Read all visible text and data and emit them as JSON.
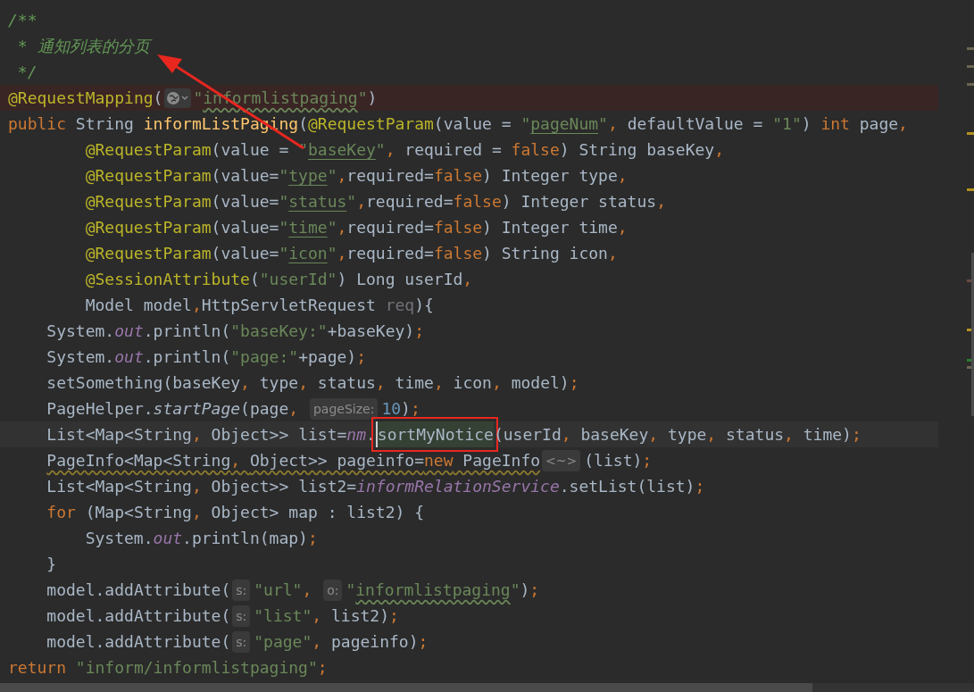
{
  "editor": {
    "lines": [
      {
        "kind": "top",
        "tokens": [
          {
            "text": "/**",
            "kind": "doc"
          }
        ]
      },
      {
        "kind": "top",
        "tokens": [
          {
            "text": " * 通知列表的分页",
            "kind": "doc"
          }
        ]
      },
      {
        "kind": "top",
        "tokens": [
          {
            "text": " */",
            "kind": "doc"
          }
        ]
      },
      {
        "kind": "error",
        "tokens": [
          {
            "text": "@RequestMapping",
            "kind": "ann"
          },
          {
            "text": "(",
            "kind": "plain"
          },
          {
            "kind": "globe"
          },
          {
            "text": "\"",
            "kind": "str"
          },
          {
            "text": "informlistpaging",
            "kind": "str",
            "typo": true
          },
          {
            "text": "\"",
            "kind": "str"
          },
          {
            "text": ")",
            "kind": "plain"
          }
        ]
      },
      {
        "kind": "top",
        "tokens": [
          {
            "text": "public",
            "kind": "kw"
          },
          {
            "text": " String ",
            "kind": "plain"
          },
          {
            "text": "informListPaging",
            "kind": "method"
          },
          {
            "text": "(",
            "kind": "plain"
          },
          {
            "text": "@RequestParam",
            "kind": "ann"
          },
          {
            "text": "(value = ",
            "kind": "plain"
          },
          {
            "text": "\"",
            "kind": "str"
          },
          {
            "text": "pageNum",
            "kind": "str",
            "link": true
          },
          {
            "text": "\"",
            "kind": "str"
          },
          {
            "text": ", ",
            "kind": "kw"
          },
          {
            "text": "defaultValue = ",
            "kind": "plain"
          },
          {
            "text": "\"1\"",
            "kind": "str"
          },
          {
            "text": ") ",
            "kind": "plain"
          },
          {
            "text": "int",
            "kind": "kw"
          },
          {
            "text": " page",
            "kind": "plain"
          },
          {
            "text": ",",
            "kind": "kw"
          }
        ]
      },
      {
        "kind": "param",
        "tokens": [
          {
            "text": "@RequestParam",
            "kind": "ann"
          },
          {
            "text": "(value = ",
            "kind": "plain"
          },
          {
            "text": "\"",
            "kind": "str"
          },
          {
            "text": "baseKey",
            "kind": "str",
            "link": true
          },
          {
            "text": "\"",
            "kind": "str"
          },
          {
            "text": ", ",
            "kind": "kw"
          },
          {
            "text": "required = ",
            "kind": "plain"
          },
          {
            "text": "false",
            "kind": "kw"
          },
          {
            "text": ") String baseKey",
            "kind": "plain"
          },
          {
            "text": ",",
            "kind": "kw"
          }
        ]
      },
      {
        "kind": "param",
        "tokens": [
          {
            "text": "@RequestParam",
            "kind": "ann"
          },
          {
            "text": "(value=",
            "kind": "plain"
          },
          {
            "text": "\"",
            "kind": "str"
          },
          {
            "text": "type",
            "kind": "str",
            "link": true
          },
          {
            "text": "\"",
            "kind": "str"
          },
          {
            "text": ",",
            "kind": "kw"
          },
          {
            "text": "required=",
            "kind": "plain"
          },
          {
            "text": "false",
            "kind": "kw"
          },
          {
            "text": ") Integer type",
            "kind": "plain"
          },
          {
            "text": ",",
            "kind": "kw"
          }
        ]
      },
      {
        "kind": "param",
        "tokens": [
          {
            "text": "@RequestParam",
            "kind": "ann"
          },
          {
            "text": "(value=",
            "kind": "plain"
          },
          {
            "text": "\"",
            "kind": "str"
          },
          {
            "text": "status",
            "kind": "str",
            "link": true
          },
          {
            "text": "\"",
            "kind": "str"
          },
          {
            "text": ",",
            "kind": "kw"
          },
          {
            "text": "required=",
            "kind": "plain"
          },
          {
            "text": "false",
            "kind": "kw"
          },
          {
            "text": ") Integer status",
            "kind": "plain"
          },
          {
            "text": ",",
            "kind": "kw"
          }
        ]
      },
      {
        "kind": "param",
        "tokens": [
          {
            "text": "@RequestParam",
            "kind": "ann"
          },
          {
            "text": "(value=",
            "kind": "plain"
          },
          {
            "text": "\"",
            "kind": "str"
          },
          {
            "text": "time",
            "kind": "str",
            "link": true
          },
          {
            "text": "\"",
            "kind": "str"
          },
          {
            "text": ",",
            "kind": "kw"
          },
          {
            "text": "required=",
            "kind": "plain"
          },
          {
            "text": "false",
            "kind": "kw"
          },
          {
            "text": ") Integer time",
            "kind": "plain"
          },
          {
            "text": ",",
            "kind": "kw"
          }
        ]
      },
      {
        "kind": "param",
        "tokens": [
          {
            "text": "@RequestParam",
            "kind": "ann"
          },
          {
            "text": "(value=",
            "kind": "plain"
          },
          {
            "text": "\"",
            "kind": "str"
          },
          {
            "text": "icon",
            "kind": "str",
            "link": true
          },
          {
            "text": "\"",
            "kind": "str"
          },
          {
            "text": ",",
            "kind": "kw"
          },
          {
            "text": "required=",
            "kind": "plain"
          },
          {
            "text": "false",
            "kind": "kw"
          },
          {
            "text": ") String icon",
            "kind": "plain"
          },
          {
            "text": ",",
            "kind": "kw"
          }
        ]
      },
      {
        "kind": "param",
        "tokens": [
          {
            "text": "@SessionAttribute",
            "kind": "ann"
          },
          {
            "text": "(",
            "kind": "plain"
          },
          {
            "text": "\"userId\"",
            "kind": "str"
          },
          {
            "text": ") Long userId",
            "kind": "plain"
          },
          {
            "text": ",",
            "kind": "kw"
          }
        ]
      },
      {
        "kind": "param",
        "tokens": [
          {
            "text": "Model model",
            "kind": "plain"
          },
          {
            "text": ",",
            "kind": "kw"
          },
          {
            "text": "HttpServletRequest ",
            "kind": "plain"
          },
          {
            "text": "req",
            "kind": "unused"
          },
          {
            "text": "){",
            "kind": "plain"
          }
        ]
      },
      {
        "kind": "body",
        "tokens": [
          {
            "text": "System.",
            "kind": "plain"
          },
          {
            "text": "out",
            "kind": "field"
          },
          {
            "text": ".println(",
            "kind": "plain"
          },
          {
            "text": "\"baseKey:\"",
            "kind": "str"
          },
          {
            "text": "+baseKey)",
            "kind": "plain"
          },
          {
            "text": ";",
            "kind": "kw"
          }
        ]
      },
      {
        "kind": "body",
        "tokens": [
          {
            "text": "System.",
            "kind": "plain"
          },
          {
            "text": "out",
            "kind": "field"
          },
          {
            "text": ".println(",
            "kind": "plain"
          },
          {
            "text": "\"page:\"",
            "kind": "str"
          },
          {
            "text": "+page)",
            "kind": "plain"
          },
          {
            "text": ";",
            "kind": "kw"
          }
        ]
      },
      {
        "kind": "body",
        "tokens": [
          {
            "text": "setSomething(baseKey",
            "kind": "plain"
          },
          {
            "text": ", ",
            "kind": "kw"
          },
          {
            "text": "type",
            "kind": "plain"
          },
          {
            "text": ", ",
            "kind": "kw"
          },
          {
            "text": "status",
            "kind": "plain"
          },
          {
            "text": ", ",
            "kind": "kw"
          },
          {
            "text": "time",
            "kind": "plain"
          },
          {
            "text": ", ",
            "kind": "kw"
          },
          {
            "text": "icon",
            "kind": "plain"
          },
          {
            "text": ", ",
            "kind": "kw"
          },
          {
            "text": "model)",
            "kind": "plain"
          },
          {
            "text": ";",
            "kind": "kw"
          }
        ]
      },
      {
        "kind": "body",
        "tokens": [
          {
            "text": "PageHelper.",
            "kind": "plain"
          },
          {
            "text": "startPage",
            "kind": "static"
          },
          {
            "text": "(page",
            "kind": "plain"
          },
          {
            "text": ", ",
            "kind": "kw"
          },
          {
            "text": "pageSize:",
            "kind": "hint"
          },
          {
            "text": "10",
            "kind": "num"
          },
          {
            "text": ")",
            "kind": "plain"
          },
          {
            "text": ";",
            "kind": "kw"
          }
        ]
      },
      {
        "kind": "current",
        "tokens": [
          {
            "text": "List<Map<String",
            "kind": "plain"
          },
          {
            "text": ", ",
            "kind": "kw"
          },
          {
            "text": "Object>> list=",
            "kind": "plain"
          },
          {
            "text": "nm",
            "kind": "field"
          },
          {
            "text": ".",
            "kind": "plain"
          },
          {
            "text": "sortMyNotice",
            "kind": "plain",
            "boxed": true,
            "caret": true
          },
          {
            "text": "(userId",
            "kind": "plain"
          },
          {
            "text": ", ",
            "kind": "kw"
          },
          {
            "text": "baseKey",
            "kind": "plain"
          },
          {
            "text": ", ",
            "kind": "kw"
          },
          {
            "text": "type",
            "kind": "plain"
          },
          {
            "text": ", ",
            "kind": "kw"
          },
          {
            "text": "status",
            "kind": "plain"
          },
          {
            "text": ", ",
            "kind": "kw"
          },
          {
            "text": "time)",
            "kind": "plain"
          },
          {
            "text": ";",
            "kind": "kw"
          }
        ]
      },
      {
        "kind": "body",
        "tokens": [
          {
            "text": "PageInfo<Map<String",
            "kind": "plain",
            "warning": true
          },
          {
            "text": ", ",
            "kind": "kw",
            "warning": true
          },
          {
            "text": "Object>> pageinfo=",
            "kind": "plain",
            "warning": true
          },
          {
            "text": "new",
            "kind": "kw",
            "warning": true
          },
          {
            "text": " PageInfo",
            "kind": "plain",
            "warning": true
          },
          {
            "text": "<~>",
            "kind": "hint"
          },
          {
            "text": "(list)",
            "kind": "plain"
          },
          {
            "text": ";",
            "kind": "kw"
          }
        ]
      },
      {
        "kind": "body",
        "tokens": [
          {
            "text": "List<Map<String",
            "kind": "plain"
          },
          {
            "text": ", ",
            "kind": "kw"
          },
          {
            "text": "Object>> list2=",
            "kind": "plain"
          },
          {
            "text": "informRelationService",
            "kind": "field"
          },
          {
            "text": ".setList(list)",
            "kind": "plain"
          },
          {
            "text": ";",
            "kind": "kw"
          }
        ]
      },
      {
        "kind": "body",
        "tokens": [
          {
            "text": "for",
            "kind": "kw"
          },
          {
            "text": " (Map<String",
            "kind": "plain"
          },
          {
            "text": ", ",
            "kind": "kw"
          },
          {
            "text": "Object> map : list2) {",
            "kind": "plain"
          }
        ]
      },
      {
        "kind": "nested",
        "tokens": [
          {
            "text": "System.",
            "kind": "plain"
          },
          {
            "text": "out",
            "kind": "field"
          },
          {
            "text": ".println(map)",
            "kind": "plain"
          },
          {
            "text": ";",
            "kind": "kw"
          }
        ]
      },
      {
        "kind": "body",
        "tokens": [
          {
            "text": "}",
            "kind": "plain"
          }
        ]
      },
      {
        "kind": "body",
        "tokens": [
          {
            "text": "model.addAttribute(",
            "kind": "plain"
          },
          {
            "text": "s:",
            "kind": "hint"
          },
          {
            "text": "\"url\"",
            "kind": "str"
          },
          {
            "text": ", ",
            "kind": "kw"
          },
          {
            "text": "o:",
            "kind": "hint"
          },
          {
            "text": "\"",
            "kind": "str"
          },
          {
            "text": "informlistpaging",
            "kind": "str",
            "typo": true
          },
          {
            "text": "\"",
            "kind": "str"
          },
          {
            "text": ")",
            "kind": "plain"
          },
          {
            "text": ";",
            "kind": "kw"
          }
        ]
      },
      {
        "kind": "body",
        "tokens": [
          {
            "text": "model.addAttribute(",
            "kind": "plain"
          },
          {
            "text": "s:",
            "kind": "hint"
          },
          {
            "text": "\"list\"",
            "kind": "str"
          },
          {
            "text": ", ",
            "kind": "kw"
          },
          {
            "text": "list2)",
            "kind": "plain"
          },
          {
            "text": ";",
            "kind": "kw"
          }
        ]
      },
      {
        "kind": "body",
        "tokens": [
          {
            "text": "model.addAttribute(",
            "kind": "plain"
          },
          {
            "text": "s:",
            "kind": "hint"
          },
          {
            "text": "\"page\"",
            "kind": "str"
          },
          {
            "text": ", ",
            "kind": "kw"
          },
          {
            "text": "pageinfo)",
            "kind": "plain"
          },
          {
            "text": ";",
            "kind": "kw"
          }
        ]
      },
      {
        "kind": "top",
        "tokens": [
          {
            "text": "return",
            "kind": "kw"
          },
          {
            "text": "\"inform/informlistpaging\"",
            "kind": "str",
            "spaced": true
          },
          {
            "text": ";",
            "kind": "kw"
          }
        ]
      }
    ]
  }
}
